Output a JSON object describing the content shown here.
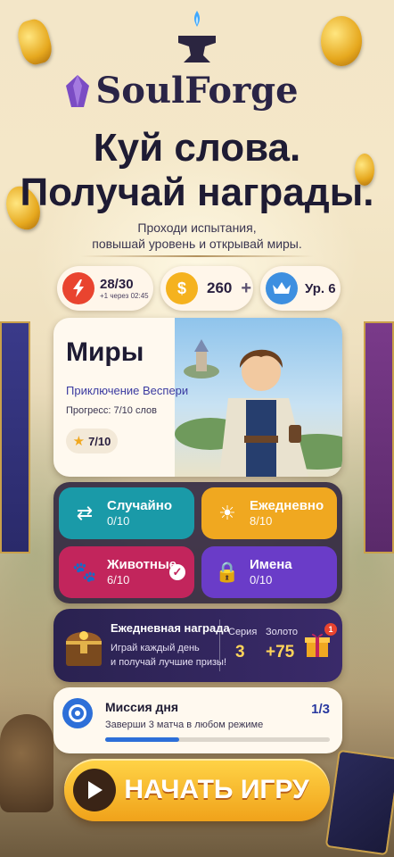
{
  "app": {
    "name": "SoulForge"
  },
  "hero": {
    "title_line1": "Куй слова.",
    "title_line2": "Получай награды.",
    "subtitle_line1": "Проходи испытания,",
    "subtitle_line2": "повышай уровень и открывай миры."
  },
  "stats": {
    "energy": {
      "value": "28/30",
      "timer": "+1 через 02:45",
      "icon": "lightning-icon",
      "color": "#e9442f"
    },
    "coins": {
      "value": "260",
      "plus": "+",
      "icon": "coin-icon",
      "color": "#f5b21e"
    },
    "level": {
      "value": "Ур. 6",
      "icon": "crown-icon",
      "color": "#3d8fe0"
    }
  },
  "worlds": {
    "title": "Миры",
    "world_name": "Приключение Веспери",
    "progress": "Прогресс: 7/10 слов",
    "stars": "7/10"
  },
  "modes": [
    {
      "label": "Случайно",
      "value": "0/10",
      "icon": "shuffle-icon",
      "color": "#1a9aa8"
    },
    {
      "label": "Ежедневно",
      "value": "8/10",
      "icon": "sun-icon",
      "color": "#f0a820"
    },
    {
      "label": "Животные",
      "value": "6/10",
      "icon": "paw-icon",
      "color": "#c2255c",
      "done": true
    },
    {
      "label": "Имена",
      "value": "0/10",
      "icon": "lock-icon",
      "color": "#6a3cc8"
    }
  ],
  "daily_reward": {
    "title": "Ежедневная награда",
    "desc_line1": "Играй каждый день",
    "desc_line2": "и получай лучшие призы!",
    "streak_label": "Серия",
    "streak_value": "3",
    "gold_label": "Золото",
    "gold_value": "+75",
    "badge": "1"
  },
  "mission": {
    "title": "Миссия дня",
    "desc": "Заверши 3 матча в любом режиме",
    "count": "1/3",
    "progress": 0.33
  },
  "start_button": {
    "label": "НАЧАТЬ ИГРУ"
  }
}
